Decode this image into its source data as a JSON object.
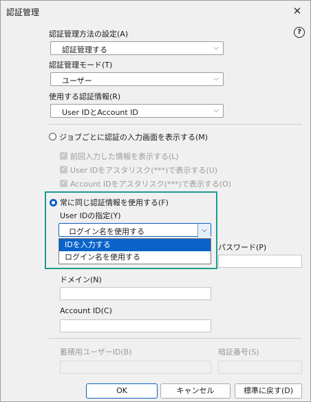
{
  "window": {
    "title": "認証管理",
    "close_glyph": "✕"
  },
  "help_glyph": "?",
  "auth_method": {
    "label": "認証管理方法の設定(A)",
    "value": "認証管理する"
  },
  "auth_mode": {
    "label": "認証管理モード(T)",
    "value": "ユーザー"
  },
  "auth_info": {
    "label": "使用する認証情報(R)",
    "value": "User IDとAccount ID"
  },
  "per_job": {
    "label": "ジョブごとに認証の入力画面を表示する(M)",
    "options": [
      "前回入力した情報を表示する(L)",
      "User IDをアスタリスク(***)で表示する(U)",
      "Account IDをアスタリスク(***)で表示する(O)"
    ]
  },
  "always_same": {
    "label": "常に同じ認証情報を使用する(F)",
    "user_id_spec_label": "User IDの指定(Y)",
    "selected_value": "ログイン名を使用する",
    "dropdown_options": [
      "IDを入力する",
      "ログイン名を使用する"
    ]
  },
  "password_label": "パスワード(P)",
  "domain_label": "ドメイン(N)",
  "account_id_label": "Account ID(C)",
  "storage_user_id_label": "蓄積用ユーザーID(B)",
  "pin_label": "暗証番号(S)",
  "buttons": {
    "ok": "OK",
    "cancel": "キャンセル",
    "reset": "標準に戻す(D)"
  },
  "colors": {
    "accent": "#0a63c9",
    "highlight_frame": "#1e9a8f"
  }
}
